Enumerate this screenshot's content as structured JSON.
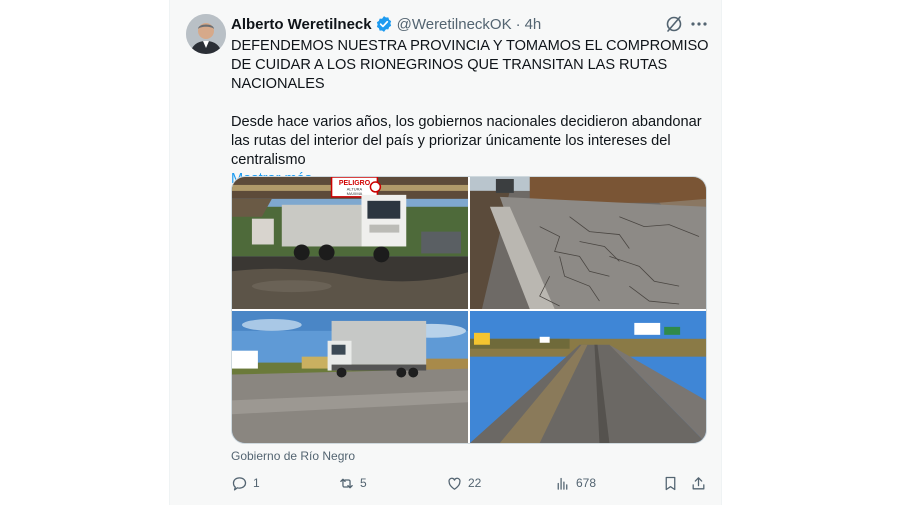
{
  "tweet": {
    "author_name": "Alberto Weretilneck",
    "handle": "@WeretilneckOK",
    "separator": "·",
    "time": "4h",
    "paragraph_1": "DEFENDEMOS NUESTRA PROVINCIA Y TOMAMOS EL COMPROMISO DE CUIDAR A LOS RIONEGRINOS QUE TRANSITAN LAS RUTAS NACIONALES",
    "paragraph_2": "Desde hace varios años, los gobiernos nacionales decidieron abandonar las rutas del interior del país y priorizar únicamente los intereses del centralismo",
    "show_more": "Mostrar más",
    "attribution": "Gobierno de Río Negro",
    "photo_1_sign_line_1": "PELIGRO",
    "photo_1_sign_line_2": "ALTURA",
    "photo_1_sign_line_3": "MAXIMA"
  },
  "actions": {
    "replies": "1",
    "reposts": "5",
    "likes": "22",
    "views": "678"
  },
  "colors": {
    "link": "#1d9bf0",
    "verified": "#1d9bf0",
    "muted": "#536471",
    "text": "#0f1419"
  },
  "icons": [
    "verified-badge-icon",
    "grok-icon",
    "more-icon",
    "reply-icon",
    "repost-icon",
    "like-icon",
    "views-icon",
    "bookmark-icon",
    "share-icon"
  ]
}
